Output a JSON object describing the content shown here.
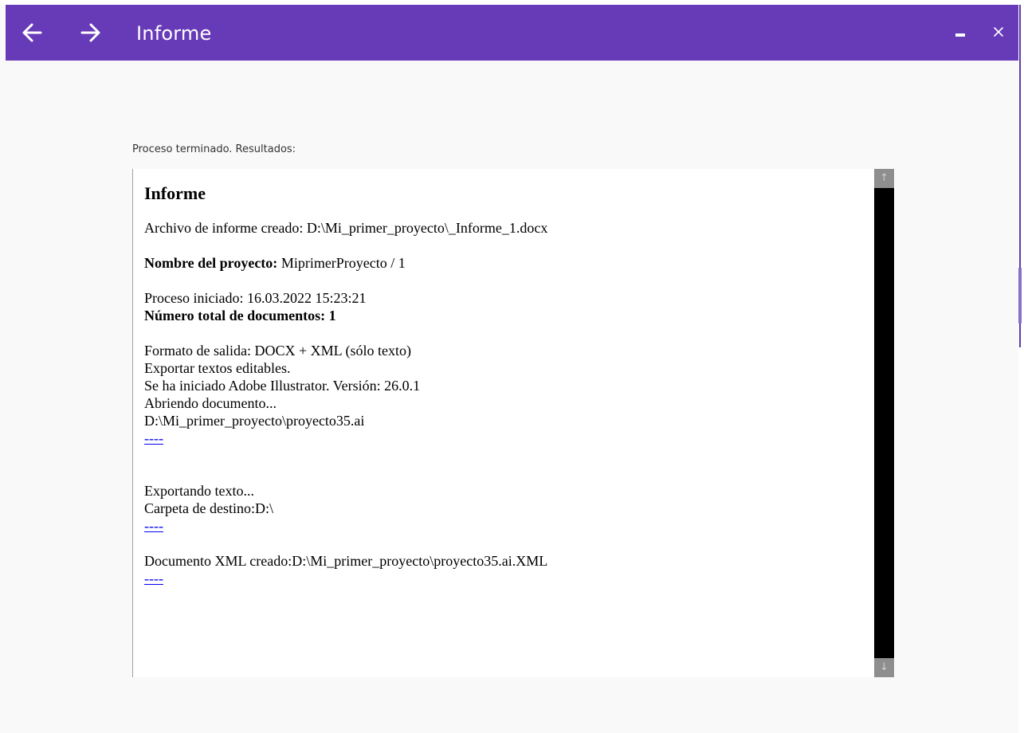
{
  "window": {
    "title": "Informe",
    "accent_color": "#673ab7",
    "back_icon": "arrow-left-icon",
    "forward_icon": "arrow-right-icon",
    "minimize_icon": "minimize-icon",
    "close_icon": "close-icon"
  },
  "status_text": "Proceso terminado. Resultados:",
  "report": {
    "title": "Informe",
    "file_created": "Archivo de informe creado: D:\\Mi_primer_proyecto\\_Informe_1.docx",
    "project_label": "Nombre del proyecto:",
    "project_value": " MiprimerProyecto / 1",
    "process_started": "Proceso iniciado: 16.03.2022 15:23:21",
    "total_documents": "Número total de documentos: 1",
    "output_format": "Formato de salida: DOCX + XML (sólo texto)",
    "export_editable": "Exportar textos editables.",
    "illustrator_started": "Se ha iniciado Adobe Illustrator. Versión: 26.0.1",
    "opening_document": "Abriendo documento...",
    "document_path": "D:\\Mi_primer_proyecto\\proyecto35.ai",
    "separator_link_1": "----",
    "exporting_text": "Exportando texto...",
    "destination_folder": "Carpeta de destino:D:\\",
    "separator_link_2": "----",
    "xml_created": "Documento XML creado:D:\\Mi_primer_proyecto\\proyecto35.ai.XML",
    "separator_link_3": "----"
  },
  "scrollbar": {
    "up_arrow": "↑",
    "down_arrow": "↓"
  }
}
